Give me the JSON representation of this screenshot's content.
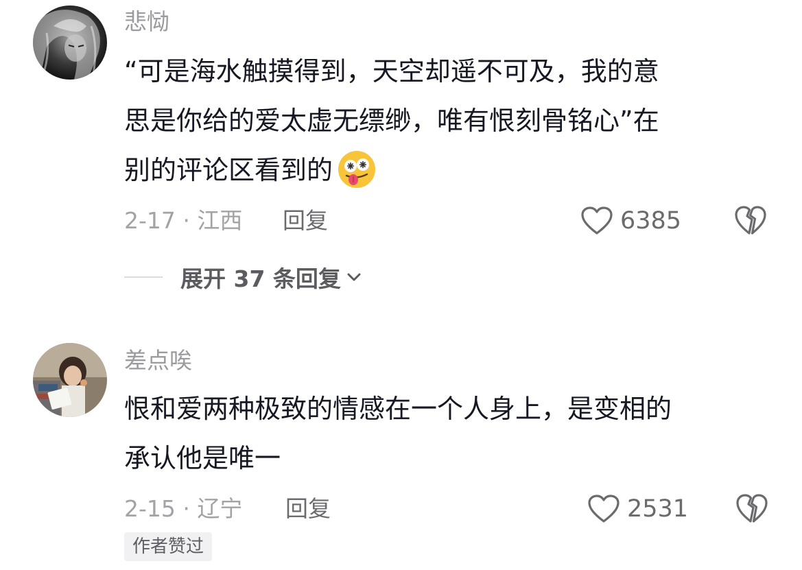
{
  "comments": [
    {
      "username": "悲恸",
      "avatar_icon": "dark-haired-anime-avatar",
      "text_lines": [
        "“可是海水触摸得到，天空却遥不可及，我的意",
        "思是你给的爱太虚无缥缈，唯有恨刻骨铭心”在",
        "别的评论区看到的"
      ],
      "emoji_icon": "dizzy-tongue-out-emoji",
      "date_location": "2-17 · 江西",
      "reply_label": "回复",
      "like_icon": "heart-outline-icon",
      "like_count": "6385",
      "dislike_icon": "broken-heart-icon",
      "expand_label": "展开 37 条回复",
      "expand_icon": "chevron-down-icon"
    },
    {
      "username": "差点唉",
      "avatar_icon": "person-photo-avatar",
      "text_lines": [
        "恨和爱两种极致的情感在一个人身上，是变相的",
        "承认他是唯一"
      ],
      "date_location": "2-15 · 辽宁",
      "reply_label": "回复",
      "like_icon": "heart-outline-icon",
      "like_count": "2531",
      "dislike_icon": "broken-heart-icon",
      "badge": "作者赞过"
    }
  ],
  "colors": {
    "text": "#161823",
    "secondary": "#9b9b9f",
    "icon": "#6b6b6f",
    "badge_bg": "#f1f1f3",
    "emoji_face": "#f8c43a",
    "emoji_tongue": "#e84b6a"
  }
}
